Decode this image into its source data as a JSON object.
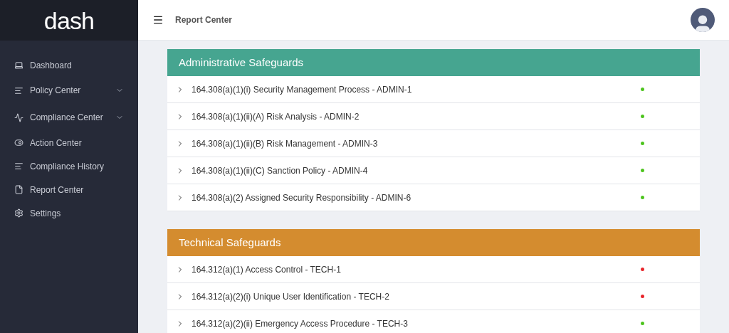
{
  "logo": "dash",
  "sidebar": {
    "items": [
      {
        "label": "Dashboard",
        "kind": "link"
      },
      {
        "label": "Policy Center",
        "kind": "group"
      },
      {
        "label": "Compliance Center",
        "kind": "group"
      },
      {
        "label": "Action Center",
        "kind": "link"
      },
      {
        "label": "Compliance History",
        "kind": "link"
      },
      {
        "label": "Report Center",
        "kind": "link"
      },
      {
        "label": "Settings",
        "kind": "link"
      }
    ]
  },
  "topbar": {
    "title": "Report Center"
  },
  "sections": [
    {
      "title": "Administrative Safeguards",
      "color": "#46a590",
      "items": [
        {
          "label": "164.308(a)(1)(i) Security Management Process - ADMIN-1",
          "color": "#4ec41f"
        },
        {
          "label": "164.308(a)(1)(ii)(A) Risk Analysis - ADMIN-2",
          "color": "#4ec41f"
        },
        {
          "label": "164.308(a)(1)(ii)(B) Risk Management - ADMIN-3",
          "color": "#4ec41f"
        },
        {
          "label": "164.308(a)(1)(ii)(C) Sanction Policy - ADMIN-4",
          "color": "#4ec41f"
        },
        {
          "label": "164.308(a)(2) Assigned Security Responsibility - ADMIN-6",
          "color": "#4ec41f"
        }
      ]
    },
    {
      "title": "Technical Safeguards",
      "color": "#d48c2f",
      "items": [
        {
          "label": "164.312(a)(1) Access Control - TECH-1",
          "color": "#e8262c"
        },
        {
          "label": "164.312(a)(2)(i) Unique User Identification - TECH-2",
          "color": "#e8262c"
        },
        {
          "label": "164.312(a)(2)(ii) Emergency Access Procedure - TECH-3",
          "color": "#4ec41f"
        }
      ]
    }
  ]
}
